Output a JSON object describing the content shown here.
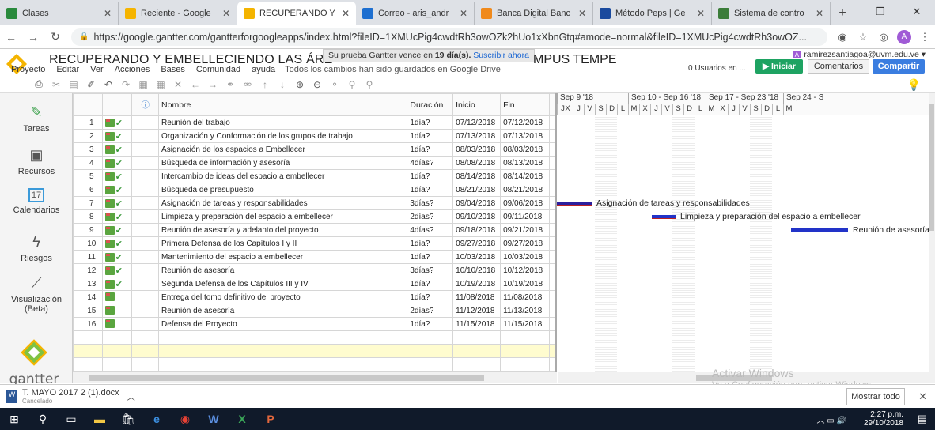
{
  "browser": {
    "tabs": [
      {
        "title": "Clases",
        "color": "#2a8a3d"
      },
      {
        "title": "Reciente - Google",
        "color": "#f5b400"
      },
      {
        "title": "RECUPERANDO Y",
        "color": "#f4b400",
        "active": true
      },
      {
        "title": "Correo - aris_andr",
        "color": "#1e6fd0"
      },
      {
        "title": "Banca Digital Banc",
        "color": "#f08a1c"
      },
      {
        "title": "Método Peps | Ge",
        "color": "#1a4a9e"
      },
      {
        "title": "Sistema de contro",
        "color": "#3c7d3a"
      }
    ],
    "url": "https://google.gantter.com/gantterforgoogleapps/index.html?fileID=1XMUcPig4cwdtRh3owOZk2hUo1xXbnGtq#amode=normal&fileID=1XMUcPig4cwdtRh3owOZ..."
  },
  "app": {
    "title": "RECUPERANDO Y EMBELLECIENDO LAS ÁRE",
    "title_tail": "MPUS TEMPE",
    "trial_text": "Su prueba Gantter vence en ",
    "trial_days": "19 día(s).",
    "trial_link": "Suscribir ahora",
    "menu": [
      "Proyecto",
      "Editar",
      "Ver",
      "Acciones",
      "Bases",
      "Comunidad",
      "ayuda"
    ],
    "saved_msg": "Todos los cambios han sido guardados en Google Drive",
    "user_email": "ramirezsantiagoa@uvm.edu.ve",
    "users_online": "0 Usuarios en ...",
    "btn_iniciar": "Iniciar",
    "btn_comentarios": "Comentarios",
    "btn_compartir": "Compartir"
  },
  "sidebar": [
    {
      "label": "Tareas",
      "icon": "edit-icon"
    },
    {
      "label": "Recursos",
      "icon": "resources-icon"
    },
    {
      "label": "Calendarios",
      "icon": "calendar-icon"
    },
    {
      "label": "Riesgos",
      "icon": "lightning-icon"
    },
    {
      "label": "Visualización (Beta)",
      "icon": "chart-icon"
    }
  ],
  "calendar_day": "17",
  "logo_text": "gantter",
  "grid": {
    "headers": {
      "nombre": "Nombre",
      "duracion": "Duración",
      "inicio": "Inicio",
      "fin": "Fin"
    },
    "rows": [
      {
        "n": "1",
        "name": "Reunión del trabajo",
        "dur": "1día?",
        "start": "07/12/2018",
        "end": "07/12/2018",
        "done": true
      },
      {
        "n": "2",
        "name": "Organización y Conformación de los grupos de trabajo",
        "dur": "1día?",
        "start": "07/13/2018",
        "end": "07/13/2018",
        "done": true
      },
      {
        "n": "3",
        "name": "Asignación de los espacios a Embellecer",
        "dur": "1día?",
        "start": "08/03/2018",
        "end": "08/03/2018",
        "done": true
      },
      {
        "n": "4",
        "name": "Búsqueda de información y asesoría",
        "dur": "4días?",
        "start": "08/08/2018",
        "end": "08/13/2018",
        "done": true
      },
      {
        "n": "5",
        "name": "Intercambio de ideas del espacio a embellecer",
        "dur": "1día?",
        "start": "08/14/2018",
        "end": "08/14/2018",
        "done": true
      },
      {
        "n": "6",
        "name": "Búsqueda de presupuesto",
        "dur": "1día?",
        "start": "08/21/2018",
        "end": "08/21/2018",
        "done": true
      },
      {
        "n": "7",
        "name": "Asignación de tareas y responsabilidades",
        "dur": "3días?",
        "start": "09/04/2018",
        "end": "09/06/2018",
        "done": true
      },
      {
        "n": "8",
        "name": "Limpieza y preparación del espacio a embellecer",
        "dur": "2días?",
        "start": "09/10/2018",
        "end": "09/11/2018",
        "done": true
      },
      {
        "n": "9",
        "name": "Reunión de asesoría y adelanto del proyecto",
        "dur": "4días?",
        "start": "09/18/2018",
        "end": "09/21/2018",
        "done": true
      },
      {
        "n": "10",
        "name": "Primera Defensa de los Capítulos I y II",
        "dur": "1día?",
        "start": "09/27/2018",
        "end": "09/27/2018",
        "done": true
      },
      {
        "n": "11",
        "name": "Mantenimiento del espacio a embellecer",
        "dur": "1día?",
        "start": "10/03/2018",
        "end": "10/03/2018",
        "done": true
      },
      {
        "n": "12",
        "name": "Reunión de asesoría",
        "dur": "3días?",
        "start": "10/10/2018",
        "end": "10/12/2018",
        "done": true
      },
      {
        "n": "13",
        "name": "Segunda  Defensa de los Capítulos III y IV",
        "dur": "1día?",
        "start": "10/19/2018",
        "end": "10/19/2018",
        "done": true
      },
      {
        "n": "14",
        "name": "Entrega del tomo definitivo del proyecto",
        "dur": "1día?",
        "start": "11/08/2018",
        "end": "11/08/2018",
        "done": false
      },
      {
        "n": "15",
        "name": "Reunión de asesoría",
        "dur": "2días?",
        "start": "11/12/2018",
        "end": "11/13/2018",
        "done": false
      },
      {
        "n": "16",
        "name": "Defensa del Proyecto",
        "dur": "1día?",
        "start": "11/15/2018",
        "end": "11/15/2018",
        "done": false
      }
    ]
  },
  "gantt": {
    "weeks": [
      "Sep 9 '18",
      "Sep 10 - Sep 16 '18",
      "Sep 17 - Sep 23 '18",
      "Sep 24 - S"
    ],
    "days": [
      "J",
      "X",
      "J",
      "V",
      "S",
      "D",
      "L",
      "M",
      "X",
      "J",
      "V",
      "S",
      "D",
      "L",
      "M",
      "X",
      "J",
      "V",
      "S",
      "D",
      "L",
      "M"
    ],
    "bars": [
      {
        "row": 7,
        "label": "Asignación de tareas y responsabilidades",
        "color": "#2b1f9e"
      },
      {
        "row": 8,
        "label": "Limpieza y preparación del espacio a embellecer",
        "color": "#2233c8"
      },
      {
        "row": 9,
        "label": "Reunión de asesoría",
        "color": "#2233c8"
      }
    ]
  },
  "watermark": {
    "title": "Activar Windows",
    "sub": "Ve a Configuración para activar Windows."
  },
  "download": {
    "file": "T. MAYO 2017 2 (1).docx",
    "status": "Cancelado",
    "show_all": "Mostrar todo"
  },
  "taskbar": {
    "time": "2:27 p.m.",
    "date": "29/10/2018"
  }
}
